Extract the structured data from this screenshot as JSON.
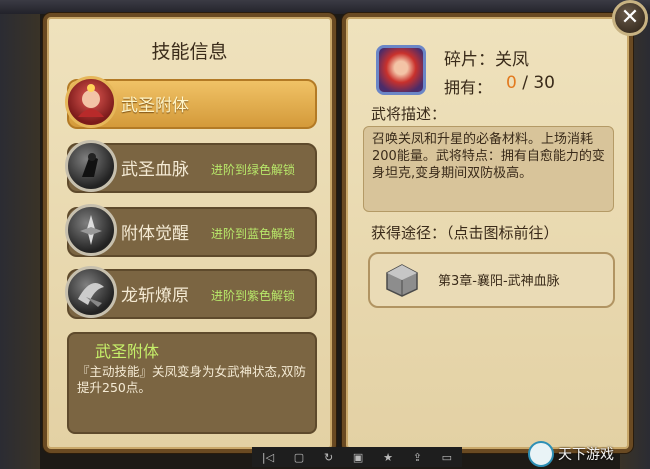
{
  "left_panel": {
    "title": "技能信息",
    "skills": [
      {
        "name": "武圣附体",
        "lock_text": "",
        "active": true,
        "icon": "hero-portrait-icon"
      },
      {
        "name": "武圣血脉",
        "lock_text": "进阶到绿色解锁",
        "active": false,
        "icon": "blood-skill-icon"
      },
      {
        "name": "附体觉醒",
        "lock_text": "进阶到蓝色解锁",
        "active": false,
        "icon": "awaken-skill-icon"
      },
      {
        "name": "龙斩燎原",
        "lock_text": "进阶到紫色解锁",
        "active": false,
        "icon": "dragon-slash-icon"
      }
    ],
    "desc": {
      "title": "武圣附体",
      "text": "『主动技能』关凤变身为女武神状态,双防提升250点。"
    }
  },
  "right_panel": {
    "fragment_label": "碎片：关凤",
    "own_label": "拥有：",
    "own_current": "0",
    "own_sep": " / 30",
    "desc_header": "武将描述：",
    "desc_text": "召唤关凤和升星的必备材料。上场消耗200能量。武将特点：拥有自愈能力的变身坦克,变身期间双防极高。",
    "obtain_header": "获得途径：（点击图标前往）",
    "route_text": "第3章-襄阳-武神血脉"
  },
  "close_symbol": "✕",
  "toolbar_icons": [
    "|◁",
    "▢",
    "↻",
    "▣",
    "★",
    "⇪",
    "▭"
  ],
  "watermark": "天下游戏"
}
